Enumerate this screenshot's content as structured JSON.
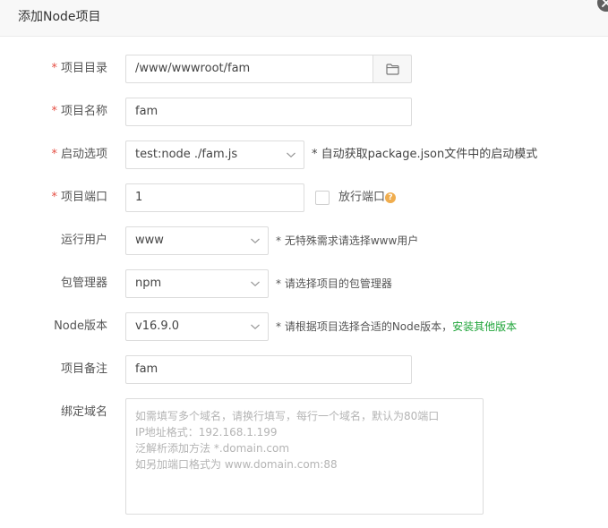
{
  "dialog": {
    "title": "添加Node项目"
  },
  "form": {
    "required_mark": "*",
    "project_dir": {
      "label": "项目目录",
      "value": "/www/wwwroot/fam"
    },
    "project_name": {
      "label": "项目名称",
      "value": "fam"
    },
    "start_option": {
      "label": "启动选项",
      "value": "test:node ./fam.js",
      "hint": "* 自动获取package.json文件中的启动模式"
    },
    "project_port": {
      "label": "项目端口",
      "value": "1",
      "open_port_label": "放行端口",
      "help": "?"
    },
    "run_user": {
      "label": "运行用户",
      "value": "www",
      "hint": "* 无特殊需求请选择www用户"
    },
    "package_manager": {
      "label": "包管理器",
      "value": "npm",
      "hint": "* 请选择项目的包管理器"
    },
    "node_version": {
      "label": "Node版本",
      "value": "v16.9.0",
      "hint": "* 请根据项目选择合适的Node版本，",
      "link": "安装其他版本"
    },
    "remark": {
      "label": "项目备注",
      "value": "fam"
    },
    "domain": {
      "label": "绑定域名",
      "placeholder_lines": [
        "如需填写多个域名，请换行填写，每行一个域名，默认为80端口",
        "IP地址格式：192.168.1.199",
        "泛解析添加方法 *.domain.com",
        "如另加端口格式为 www.domain.com:88"
      ]
    }
  }
}
